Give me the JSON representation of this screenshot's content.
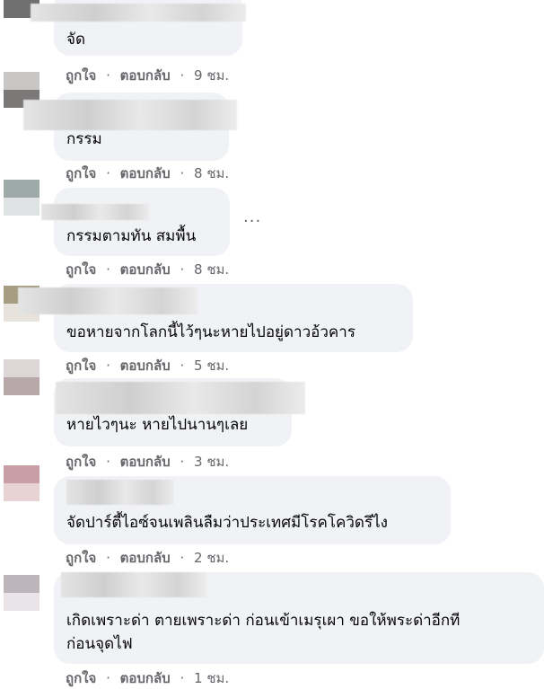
{
  "like_label": "ถูกใจ",
  "reply_label": "ตอบกลับ",
  "separator": "·",
  "comments": [
    {
      "text": "จัด",
      "time": "9 ชม."
    },
    {
      "text": "กรรม",
      "time": "8 ชม."
    },
    {
      "text": "กรรมตามทัน สมพื้น",
      "time": "8 ชม."
    },
    {
      "text": "ขอหายจากโลกนี้ไว้ๆนะหายไปอยู่ดาวอ้วคาร",
      "time": "5 ชม."
    },
    {
      "text": "หายไวๆนะ หายไปนานๆเลย",
      "time": "3 ชม."
    },
    {
      "text": "จัดปาร์ตี้ไอซ์จนเพลินลืมว่าประเทศมีโรคโควิดรึไง",
      "time": "2 ชม."
    },
    {
      "text_line1": "เกิดเพราะด่า ตายเพราะด่า ก่อนเข้าเมรุเผา ขอให้พระด่าอีกที",
      "text_line2": "ก่อนจุดไฟ",
      "time": "1 ชม."
    }
  ],
  "more_options": "···",
  "colors": {
    "bubble": "#f0f2f5",
    "text": "#050505",
    "meta": "#65676b"
  }
}
